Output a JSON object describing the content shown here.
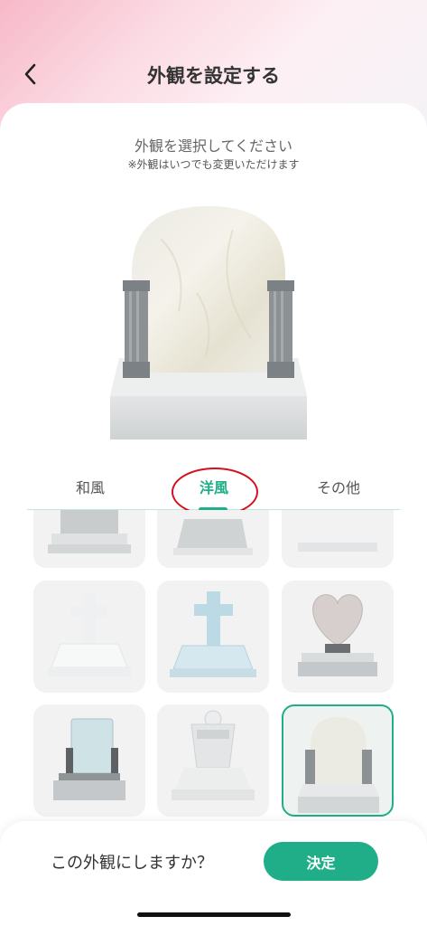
{
  "header": {
    "title": "外観を設定する",
    "back_icon": "chevron-left-icon"
  },
  "instruction": {
    "main": "外観を選択してください",
    "sub": "※外観はいつでも変更いただけます"
  },
  "tabs": [
    {
      "label": "和風",
      "active": false
    },
    {
      "label": "洋風",
      "active": true
    },
    {
      "label": "その他",
      "active": false
    }
  ],
  "grid": {
    "rows": [
      [
        "japanese-upright-stone",
        "western-flat-stone",
        "plate-stone"
      ],
      [
        "white-cross-stone",
        "blue-cross-stone",
        "heart-stone"
      ],
      [
        "glass-panel-stone",
        "pillar-medallion-stone",
        "arched-pillar-stone"
      ]
    ],
    "selected": "arched-pillar-stone"
  },
  "footer": {
    "question": "この外観にしますか？",
    "decide_label": "決定"
  },
  "colors": {
    "accent": "#1fae87",
    "annotation": "#d3111c"
  }
}
